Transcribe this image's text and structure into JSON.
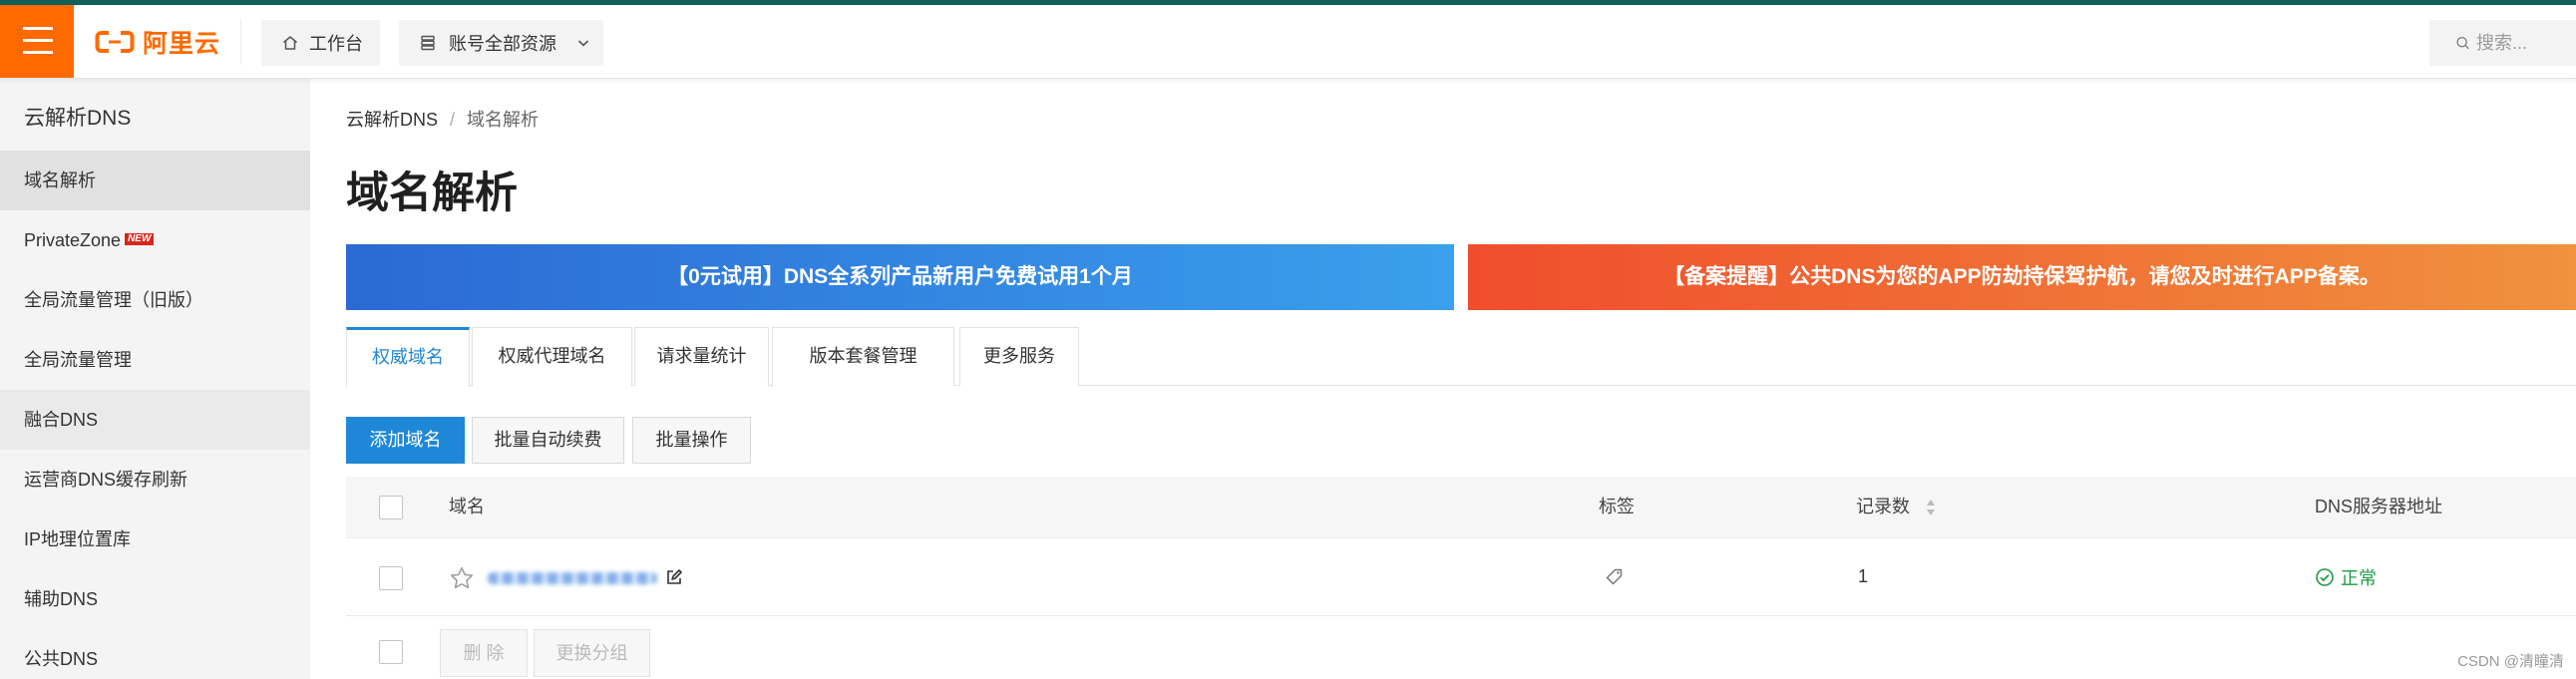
{
  "header": {
    "logo_text": "阿里云",
    "workbench_label": "工作台",
    "resource_label": "账号全部资源",
    "search_placeholder": "搜索..."
  },
  "sidebar": {
    "title": "云解析DNS",
    "items": [
      {
        "label": "域名解析",
        "active": true
      },
      {
        "label": "PrivateZone",
        "badge": "NEW"
      },
      {
        "label": "全局流量管理（旧版）"
      },
      {
        "label": "全局流量管理"
      },
      {
        "label": "融合DNS"
      },
      {
        "label": "运营商DNS缓存刷新"
      },
      {
        "label": "IP地理位置库"
      },
      {
        "label": "辅助DNS"
      },
      {
        "label": "公共DNS"
      }
    ]
  },
  "breadcrumb": {
    "items": [
      "云解析DNS",
      "域名解析"
    ],
    "separator": "/"
  },
  "page_title": "域名解析",
  "banners": [
    {
      "text": "【0元试用】DNS全系列产品新用户免费试用1个月"
    },
    {
      "text": "【备案提醒】公共DNS为您的APP防劫持保驾护航，请您及时进行APP备案。"
    }
  ],
  "tabs": {
    "items": [
      {
        "label": "权威域名",
        "active": true
      },
      {
        "label": "权威代理域名"
      },
      {
        "label": "请求量统计"
      },
      {
        "label": "版本套餐管理"
      },
      {
        "label": "更多服务"
      }
    ]
  },
  "toolbar": {
    "add_domain_label": "添加域名",
    "batch_renew_label": "批量自动续费",
    "batch_ops_label": "批量操作"
  },
  "table": {
    "columns": {
      "domain": "域名",
      "tags": "标签",
      "records": "记录数",
      "dns_servers": "DNS服务器地址"
    },
    "rows": [
      {
        "records": "1",
        "dns_status": "正常"
      }
    ]
  },
  "bulk_actions": {
    "delete_label": "删 除",
    "change_group_label": "更换分组"
  },
  "watermark": "CSDN @清瞳清",
  "icons": {
    "menu": "hamburger-icon",
    "workbench": "home-icon",
    "resources": "resource-group-icon",
    "dropdown": "chevron-down-icon",
    "search": "search-icon",
    "favorite": "star-icon",
    "edit": "edit-icon",
    "tag": "tag-icon",
    "sort": "sort-icon",
    "status_ok": "check-circle-icon"
  },
  "colors": {
    "top_strip": "#115e5b",
    "brand_orange": "#ff6a00",
    "primary_blue": "#1f87d7",
    "banner_blue_start": "#2b69d4",
    "banner_blue_end": "#3aa0ec",
    "banner_orange_start": "#f04d2c",
    "banner_orange_end": "#f0923e",
    "status_green": "#1f9a45",
    "sidebar_bg": "#f4f4f4",
    "sidebar_active_bg": "#e1e1e1",
    "new_badge": "#d9261c"
  }
}
